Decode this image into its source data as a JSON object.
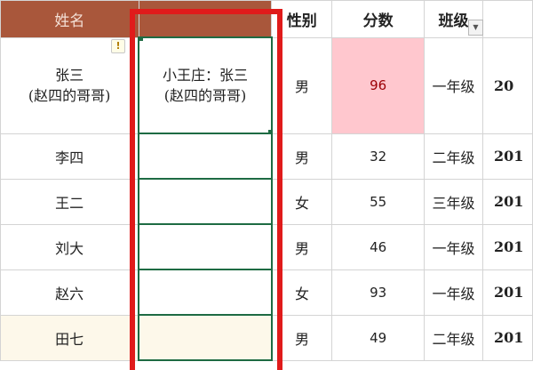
{
  "header": {
    "name": "姓名",
    "blank": "",
    "gender": "性别",
    "score": "分数",
    "class": "班级"
  },
  "rows": [
    {
      "name": "张三\n(赵四的哥哥)",
      "note": "小王庄：张三\n(赵四的哥哥)",
      "gender": "男",
      "score": "96",
      "class": "一年级",
      "year": "20"
    },
    {
      "name": "李四",
      "note": "",
      "gender": "男",
      "score": "32",
      "class": "二年级",
      "year": "201"
    },
    {
      "name": "王二",
      "note": "",
      "gender": "女",
      "score": "55",
      "class": "三年级",
      "year": "201"
    },
    {
      "name": "刘大",
      "note": "",
      "gender": "男",
      "score": "46",
      "class": "一年级",
      "year": "201"
    },
    {
      "name": "赵六",
      "note": "",
      "gender": "女",
      "score": "93",
      "class": "一年级",
      "year": "201"
    },
    {
      "name": "田七",
      "note": "",
      "gender": "男",
      "score": "49",
      "class": "二年级",
      "year": "201"
    }
  ],
  "icons": {
    "warning": "!",
    "filter_dropdown": "▼"
  },
  "colors": {
    "header_fill": "#a9573b",
    "highlight_fill": "#ffc7ce",
    "annotation_box": "#e01b1b",
    "selection_border": "#1e6b43"
  }
}
